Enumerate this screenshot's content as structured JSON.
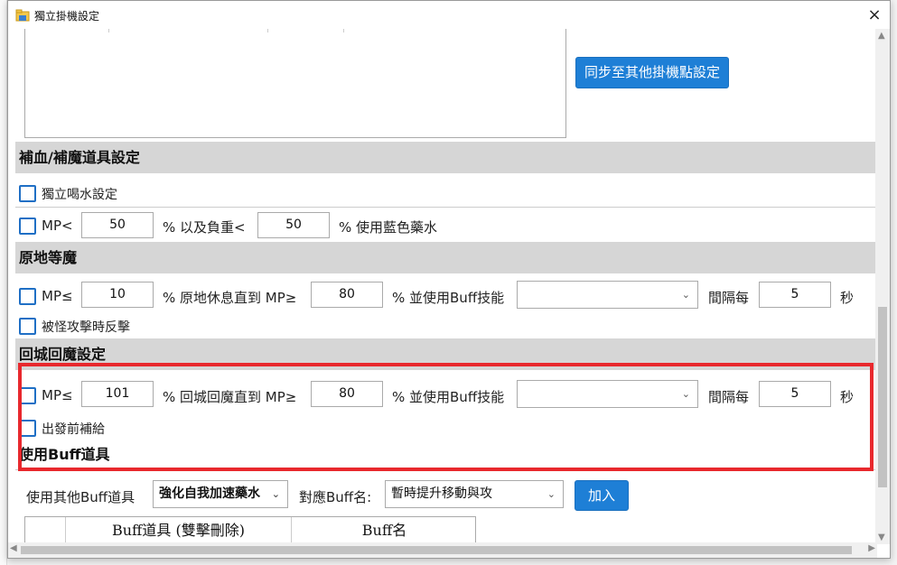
{
  "window": {
    "title": "獨立掛機設定",
    "close_glyph": "×"
  },
  "sync_button": "同步至其他掛機點設定",
  "potion_section": {
    "header": "補血/補魔道具設定",
    "independent_drink_label": "獨立喝水設定",
    "mp_label": "MP<",
    "mp_value": "50",
    "weight_label": "% 以及負重<",
    "weight_value": "50",
    "use_blue_label": "% 使用藍色藥水"
  },
  "meditate_section": {
    "header": "原地等魔",
    "mp_label": "MP≤",
    "mp_value": "10",
    "rest_label": "% 原地休息直到 MP≥",
    "rest_value": "80",
    "buff_label": "% 並使用Buff技能",
    "buff_select": "",
    "interval_label": "間隔每",
    "interval_value": "5",
    "sec_label": "秒",
    "counter_label": "被怪攻擊時反擊"
  },
  "return_section": {
    "header": "回城回魔設定",
    "mp_label": "MP≤",
    "mp_value": "101",
    "return_label": "% 回城回魔直到 MP≥",
    "return_value": "80",
    "buff_label": "% 並使用Buff技能",
    "buff_select": "",
    "interval_label": "間隔每",
    "interval_value": "5",
    "sec_label": "秒",
    "resupply_label": "出發前補給"
  },
  "buff_section": {
    "header": "使用Buff道具",
    "use_other_label": "使用其他Buff道具",
    "item_select": "強化自我加速藥水",
    "corresponding_label": "對應Buff名:",
    "buff_name_select": "暫時提升移動與攻",
    "add_button": "加入",
    "table_headers": [
      "Buff道具 (雙擊刪除)",
      "Buff名"
    ]
  },
  "colors": {
    "accent": "#1e7fd6",
    "highlight": "#e8282d",
    "section_bg": "#d6d6d6"
  }
}
